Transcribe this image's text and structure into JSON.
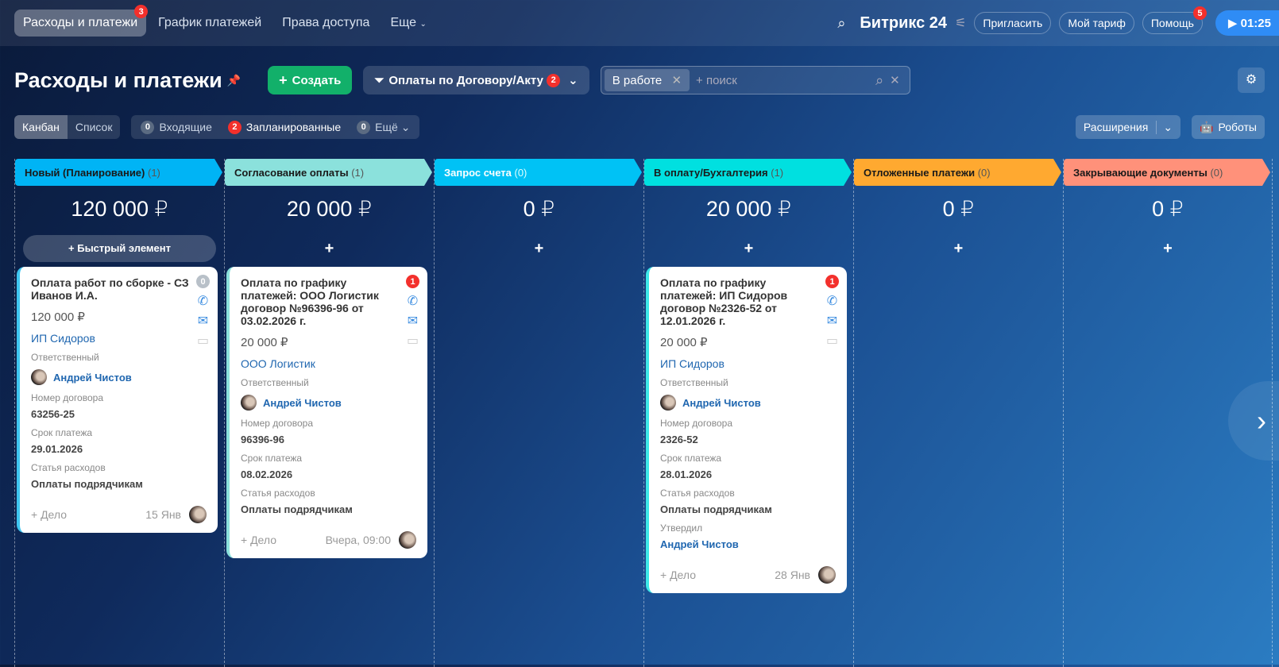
{
  "topbar": {
    "tabs": [
      {
        "label": "Расходы и платежи",
        "badge": "3"
      },
      {
        "label": "График платежей"
      },
      {
        "label": "Права доступа"
      },
      {
        "label": "Еще"
      }
    ],
    "logo": "Битрикс 24",
    "invite": "Пригласить",
    "tariff": "Мой тариф",
    "help": "Помощь",
    "help_badge": "5",
    "timer": "01:25"
  },
  "header": {
    "title": "Расходы и платежи",
    "create": "Создать",
    "filter": "Оплаты по Договору/Акту",
    "filter_badge": "2",
    "search_chip": "В работе",
    "search_placeholder": "+ поиск"
  },
  "toolbar": {
    "kanban": "Канбан",
    "list": "Список",
    "counters": [
      {
        "n": "0",
        "label": "Входящие"
      },
      {
        "n": "2",
        "label": "Запланированные"
      },
      {
        "n": "0",
        "label": "Ещё"
      }
    ],
    "extensions": "Расширения",
    "robots": "Роботы"
  },
  "columns": [
    {
      "title": "Новый (Планирование)",
      "count": "(1)",
      "sum": "120 000 ₽",
      "color": "#00b4f5",
      "quick": "Быстрый элемент"
    },
    {
      "title": "Согласование оплаты",
      "count": "(1)",
      "sum": "20 000 ₽",
      "color": "#8be1dc"
    },
    {
      "title": "Запрос счета",
      "count": "(0)",
      "sum": "0 ₽",
      "color": "#00c2f5"
    },
    {
      "title": "В оплату/Бухгалтерия",
      "count": "(1)",
      "sum": "20 000 ₽",
      "color": "#00e0e0"
    },
    {
      "title": "Отложенные платежи",
      "count": "(0)",
      "sum": "0 ₽",
      "color": "#ffa930"
    },
    {
      "title": "Закрывающие документы",
      "count": "(0)",
      "sum": "0 ₽",
      "color": "#ff917a"
    }
  ],
  "cards": [
    {
      "title": "Оплата работ по сборке - СЗ Иванов И.А.",
      "badge": "0",
      "amount": "120 000 ₽",
      "company": "ИП Сидоров",
      "resp_label": "Ответственный",
      "resp": "Андрей Чистов",
      "contract_label": "Номер договора",
      "contract": "63256-25",
      "due_label": "Срок платежа",
      "due": "29.01.2026",
      "cat_label": "Статья расходов",
      "cat": "Оплаты подрядчикам",
      "add": "+ Дело",
      "date": "15 Янв"
    },
    {
      "title": "Оплата по графику платежей: ООО Логистик договор №96396-96 от 03.02.2026 г.",
      "badge": "1",
      "amount": "20 000 ₽",
      "company": "ООО Логистик",
      "resp_label": "Ответственный",
      "resp": "Андрей Чистов",
      "contract_label": "Номер договора",
      "contract": "96396-96",
      "due_label": "Срок платежа",
      "due": "08.02.2026",
      "cat_label": "Статья расходов",
      "cat": "Оплаты подрядчикам",
      "add": "+ Дело",
      "date": "Вчера, 09:00"
    },
    {
      "title": "Оплата по графику платежей: ИП Сидоров договор №2326-52 от 12.01.2026 г.",
      "badge": "1",
      "amount": "20 000 ₽",
      "company": "ИП Сидоров",
      "resp_label": "Ответственный",
      "resp": "Андрей Чистов",
      "contract_label": "Номер договора",
      "contract": "2326-52",
      "due_label": "Срок платежа",
      "due": "28.01.2026",
      "cat_label": "Статья расходов",
      "cat": "Оплаты подрядчикам",
      "approved_label": "Утвердил",
      "approved": "Андрей Чистов",
      "add": "+ Дело",
      "date": "28 Янв"
    }
  ]
}
